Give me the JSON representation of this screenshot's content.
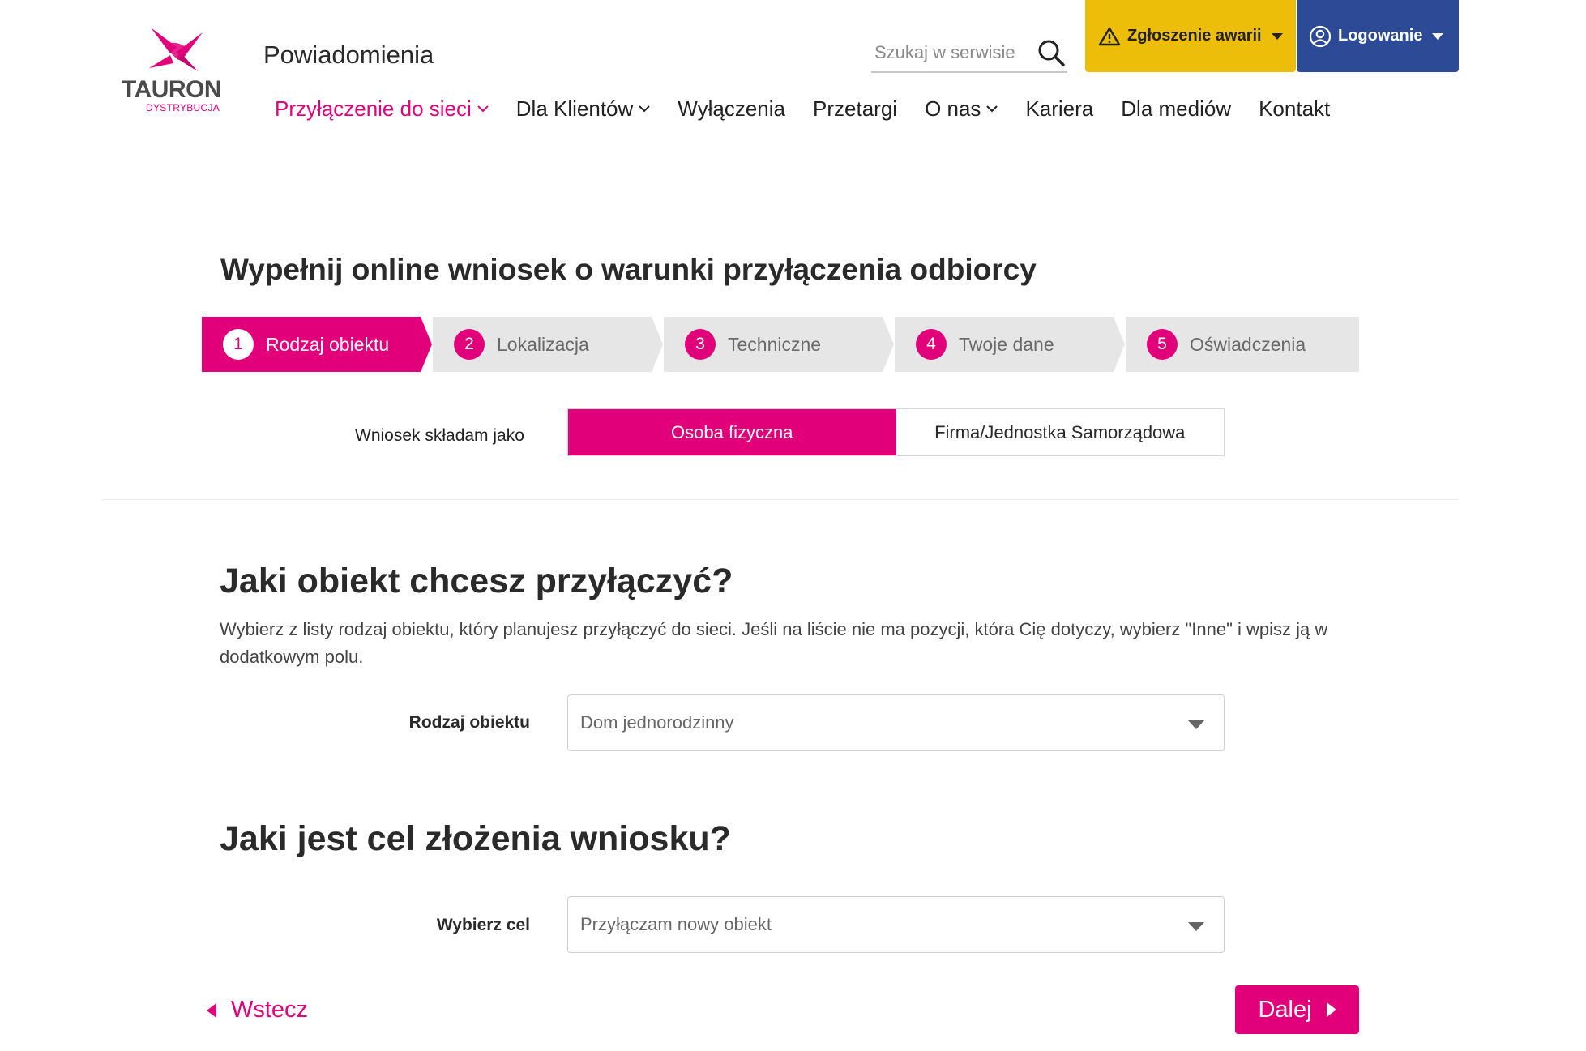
{
  "brand": {
    "name": "TAURON",
    "sub": "DYSTRYBUCJA",
    "color": "#e2007a"
  },
  "header": {
    "notifications": "Powiadomienia",
    "search_placeholder": "Szukaj w serwisie",
    "outage_label": "Zgłoszenie awarii",
    "login_label": "Logowanie"
  },
  "nav": [
    {
      "label": "Przyłączenie do sieci",
      "dropdown": true,
      "active": true
    },
    {
      "label": "Dla Klientów",
      "dropdown": true
    },
    {
      "label": "Wyłączenia",
      "dropdown": false
    },
    {
      "label": "Przetargi",
      "dropdown": false
    },
    {
      "label": "O nas",
      "dropdown": true
    },
    {
      "label": "Kariera",
      "dropdown": false
    },
    {
      "label": "Dla mediów",
      "dropdown": false
    },
    {
      "label": "Kontakt",
      "dropdown": false
    }
  ],
  "form": {
    "title": "Wypełnij online wniosek o warunki przyłączenia odbiorcy",
    "steps": [
      {
        "num": "1",
        "label": "Rodzaj obiektu",
        "active": true
      },
      {
        "num": "2",
        "label": "Lokalizacja"
      },
      {
        "num": "3",
        "label": "Techniczne"
      },
      {
        "num": "4",
        "label": "Twoje dane"
      },
      {
        "num": "5",
        "label": "Oświadczenia"
      }
    ],
    "applicant": {
      "label": "Wniosek składam jako",
      "option_person": "Osoba fizyczna",
      "option_company": "Firma/Jednostka Samorządowa"
    },
    "object_section": {
      "heading": "Jaki obiekt chcesz przyłączyć?",
      "description": "Wybierz z listy rodzaj obiektu, który planujesz przyłączyć do sieci. Jeśli na liście nie ma pozycji, która Cię dotyczy, wybierz \"Inne\" i wpisz ją w dodatkowym polu.",
      "field_label": "Rodzaj obiektu",
      "value": "Dom jednorodzinny"
    },
    "purpose_section": {
      "heading": "Jaki jest cel złożenia wniosku?",
      "field_label": "Wybierz cel",
      "value": "Przyłączam nowy obiekt"
    },
    "back_label": "Wstecz",
    "next_label": "Dalej"
  }
}
